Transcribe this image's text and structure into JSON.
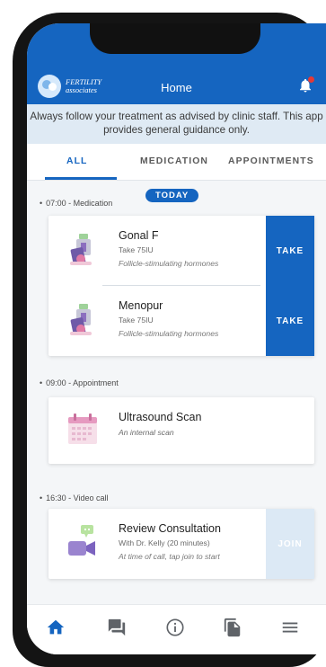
{
  "header": {
    "logo_line1": "FERTILITY",
    "logo_line2": "associates",
    "title": "Home",
    "bell_icon": "bell-icon"
  },
  "notice": "Always follow your treatment as advised by clinic staff. This app provides general guidance only.",
  "tabs": [
    {
      "label": "ALL",
      "active": true
    },
    {
      "label": "MEDICATION",
      "active": false
    },
    {
      "label": "APPOINTMENTS",
      "active": false
    }
  ],
  "today_badge": "TODAY",
  "sections": [
    {
      "label": "07:00 - Medication",
      "items": [
        {
          "title": "Gonal F",
          "subtitle": "Take 75IU",
          "note": "Follicle-stimulating hormones",
          "action": "TAKE",
          "icon": "medication-pen-icon"
        },
        {
          "title": "Menopur",
          "subtitle": "Take 75IU",
          "note": "Follicle-stimulating hormones",
          "action": "TAKE",
          "icon": "medication-pen-icon"
        }
      ]
    },
    {
      "label": "09:00 - Appointment",
      "items": [
        {
          "title": "Ultrasound Scan",
          "subtitle": "An internal scan",
          "icon": "calendar-icon"
        }
      ]
    },
    {
      "label": "16:30 - Video call",
      "items": [
        {
          "title": "Review Consultation",
          "subtitle": "With Dr. Kelly (20 minutes)",
          "note": "At time of call, tap join to start",
          "action": "JOIN",
          "icon": "video-call-icon"
        }
      ]
    }
  ],
  "bottom_nav": [
    "home-icon",
    "chat-icon",
    "info-icon",
    "documents-icon",
    "menu-icon"
  ],
  "colors": {
    "primary": "#1565c0",
    "notice_bg": "#dfeaf4",
    "disabled_action": "#dce9f5",
    "alert": "#e53935"
  }
}
